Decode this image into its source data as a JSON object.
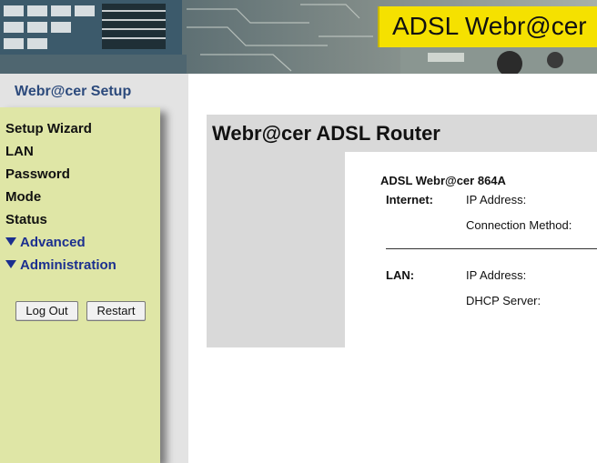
{
  "header": {
    "product_name": "ADSL Webr@cer"
  },
  "sidebar": {
    "title": "Webr@cer Setup",
    "items": [
      {
        "label": "Setup Wizard"
      },
      {
        "label": "LAN"
      },
      {
        "label": "Password"
      },
      {
        "label": "Mode"
      },
      {
        "label": "Status"
      },
      {
        "label": "Advanced"
      },
      {
        "label": "Administration"
      }
    ],
    "logout_label": "Log Out",
    "restart_label": "Restart"
  },
  "main": {
    "title": "Webr@cer ADSL Router",
    "device_model": "ADSL Webr@cer 864A",
    "internet": {
      "label": "Internet:",
      "ip_label": "IP Address:",
      "method_label": "Connection Method:"
    },
    "lan": {
      "label": "LAN:",
      "ip_label": "IP Address:",
      "dhcp_label": "DHCP Server:"
    }
  },
  "colors": {
    "banner_yellow": "#f5e100",
    "nav_panel": "#dfe6a6",
    "sidebar_title": "#2c4a7c",
    "nav_link_blue": "#1b2f8f",
    "content_gray": "#d9d9d9"
  },
  "icons": {
    "expand": "triangle-down-icon",
    "banner_art": "circuit-board-image"
  }
}
